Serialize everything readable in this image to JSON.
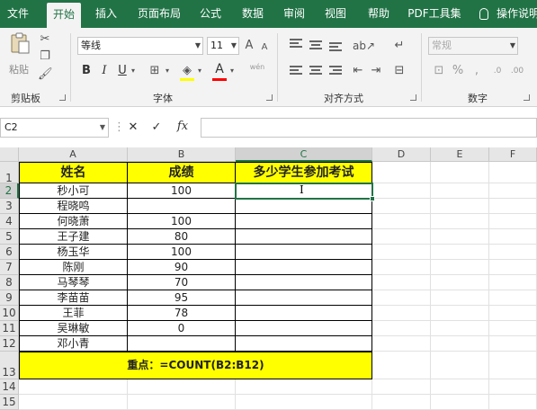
{
  "ribbon_tabs": [
    "文件",
    "开始",
    "插入",
    "页面布局",
    "公式",
    "数据",
    "审阅",
    "视图",
    "帮助",
    "PDF工具集",
    "操作说明"
  ],
  "active_tab": "开始",
  "ribbon": {
    "paste_label": "粘贴",
    "font_name": "等线",
    "font_size": "11",
    "bold": "B",
    "italic": "I",
    "underline": "U",
    "font_color_letter": "A",
    "grow_font": "A",
    "shrink_font": "A",
    "wen": "wén",
    "number_format": "常规",
    "groups": {
      "clipboard": "剪贴板",
      "font": "字体",
      "alignment": "对齐方式",
      "number": "数字"
    },
    "colors": {
      "theme": "#217346",
      "font_color": "#ff0000"
    }
  },
  "formula_bar": {
    "name_box": "C2",
    "cancel_icon": "✕",
    "enter_icon": "✓",
    "fx": "fx",
    "value": ""
  },
  "sheet": {
    "columns": [
      "A",
      "B",
      "C",
      "D",
      "E",
      "F"
    ],
    "rows": [
      "1",
      "2",
      "3",
      "4",
      "5",
      "6",
      "7",
      "8",
      "9",
      "10",
      "11",
      "12",
      "13",
      "14",
      "15"
    ],
    "headers": {
      "name": "姓名",
      "score": "成绩",
      "question": "多少学生参加考试"
    },
    "data": [
      {
        "name": "秒小可",
        "score": "100"
      },
      {
        "name": "程晓鸣",
        "score": ""
      },
      {
        "name": "何晓萧",
        "score": "100"
      },
      {
        "name": "王子建",
        "score": "80"
      },
      {
        "name": "杨玉华",
        "score": "100"
      },
      {
        "name": "陈刚",
        "score": "90"
      },
      {
        "name": "马琴琴",
        "score": "70"
      },
      {
        "name": "李苗苗",
        "score": "95"
      },
      {
        "name": "王菲",
        "score": "78"
      },
      {
        "name": "吴琳敏",
        "score": "0"
      },
      {
        "name": "邓小青",
        "score": ""
      }
    ],
    "note": "重点：=COUNT(B2:B12)",
    "selected_cell": "C2",
    "highlight_color": "#ffff00"
  }
}
